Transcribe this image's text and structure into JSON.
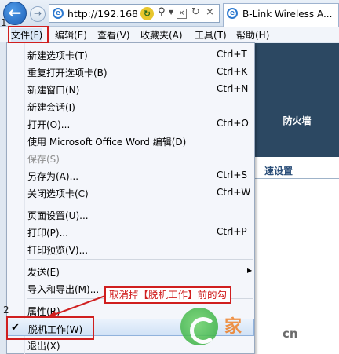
{
  "browser": {
    "url": "http://192.168",
    "tab_title": "B-Link Wireless A..."
  },
  "menubar": {
    "items": [
      "文件(F)",
      "编辑(E)",
      "查看(V)",
      "收藏夹(A)",
      "工具(T)",
      "帮助(H)"
    ]
  },
  "file_menu": {
    "items": [
      {
        "label": "新建选项卡(T)",
        "shortcut": "Ctrl+T"
      },
      {
        "label": "重复打开选项卡(B)",
        "shortcut": "Ctrl+K"
      },
      {
        "label": "新建窗口(N)",
        "shortcut": "Ctrl+N"
      },
      {
        "label": "新建会话(I)",
        "shortcut": ""
      },
      {
        "label": "打开(O)...",
        "shortcut": "Ctrl+O"
      },
      {
        "label": "使用 Microsoft Office Word 编辑(D)",
        "shortcut": ""
      },
      {
        "label": "保存(S)",
        "shortcut": ""
      },
      {
        "label": "另存为(A)...",
        "shortcut": "Ctrl+S"
      },
      {
        "label": "关闭选项卡(C)",
        "shortcut": "Ctrl+W"
      },
      {
        "label": "页面设置(U)...",
        "shortcut": ""
      },
      {
        "label": "打印(P)...",
        "shortcut": "Ctrl+P"
      },
      {
        "label": "打印预览(V)...",
        "shortcut": ""
      },
      {
        "label": "发送(E)",
        "shortcut": ""
      },
      {
        "label": "导入和导出(M)...",
        "shortcut": ""
      },
      {
        "label": "属性(R)",
        "shortcut": ""
      },
      {
        "label": "脱机工作(W)",
        "shortcut": ""
      },
      {
        "label": "退出(X)",
        "shortcut": ""
      }
    ]
  },
  "page_content": {
    "nav_label": "防火墙",
    "section_title": "速设置"
  },
  "annotations": {
    "step1": "1",
    "step2": "2",
    "callout": "取消掉【脱机工作】前的勾"
  },
  "watermark": {
    "text": "家",
    "text2": "cn"
  },
  "colors": {
    "annotation_red": "#d01f1f",
    "highlight_blue": "#d1e2f6",
    "page_dark": "#2c4862"
  }
}
